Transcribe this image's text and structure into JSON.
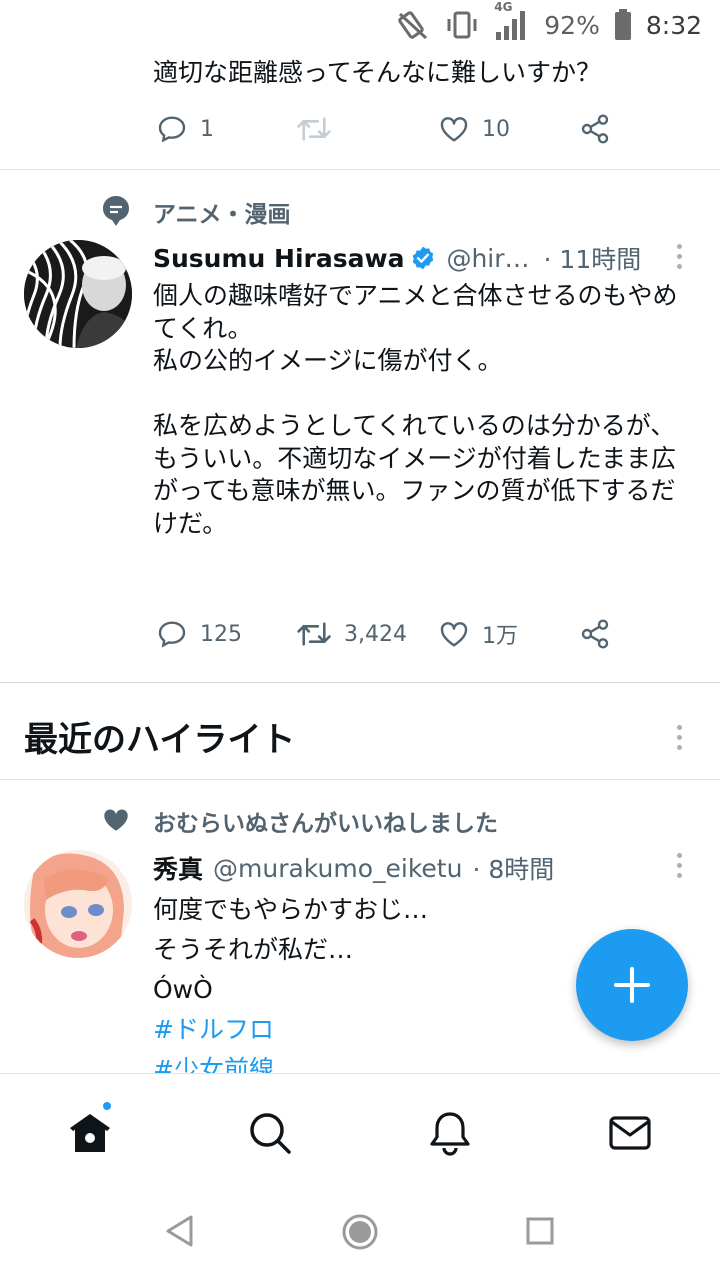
{
  "status": {
    "network": "4G",
    "battery": "92%",
    "time": "8:32"
  },
  "tweet0": {
    "text": "適切な距離感ってそんなに難しいすか？",
    "replies": "1",
    "retweets": "",
    "likes": "10"
  },
  "tweet1": {
    "context": "アニメ・漫画",
    "name": "Susumu Hirasawa",
    "handle": "@hir…",
    "time": "· 11時間",
    "text": "個人の趣味嗜好でアニメと合体させるのもやめてくれ。\n私の公的イメージに傷が付く。\n\n私を広めようとしてくれているのは分かるが、もういい。不適切なイメージが付着したまま広がっても意味が無い。ファンの質が低下するだけだ。",
    "replies": "125",
    "retweets": "3,424",
    "likes": "1万"
  },
  "highlights": {
    "title": "最近のハイライト"
  },
  "tweet2": {
    "context": "おむらいぬさんがいいねしました",
    "name": "秀真",
    "handle": "@murakumo_eiketu",
    "time": "· 8時間",
    "line1": "何度でもやらかすおじ…",
    "line2": "そうそれが私だ…",
    "line3": "ÓwÒ",
    "hashtag1": "#ドルフロ",
    "hashtag2": "#少女前線"
  },
  "colors": {
    "accent": "#1d9bf0",
    "secondary_text": "#536471"
  },
  "icons": {
    "reply": "reply-icon",
    "retweet": "retweet-icon",
    "like": "heart-icon",
    "share": "share-icon",
    "topic": "topic-icon",
    "verified": "verified-badge-icon",
    "compose": "plus-icon",
    "home": "home-icon",
    "search": "search-icon",
    "notifications": "bell-icon",
    "messages": "mail-icon"
  }
}
